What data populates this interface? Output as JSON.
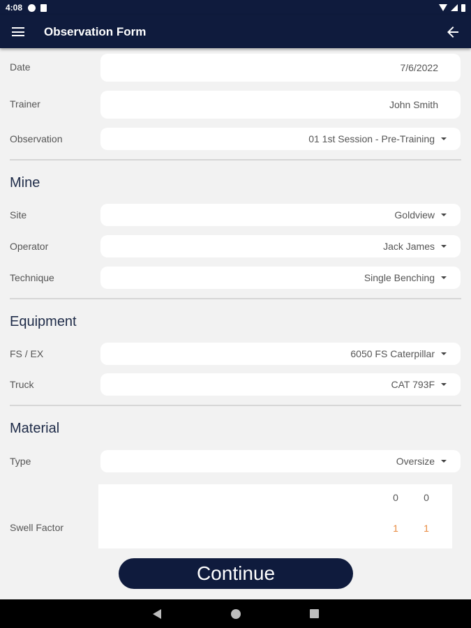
{
  "status_bar": {
    "time": "4:08"
  },
  "app_bar": {
    "title": "Observation Form",
    "menu_icon": "hamburger-menu-icon",
    "back_icon": "arrow-back-icon"
  },
  "form": {
    "date": {
      "label": "Date",
      "value": "7/6/2022"
    },
    "trainer": {
      "label": "Trainer",
      "value": "John Smith"
    },
    "observation": {
      "label": "Observation",
      "value": "01 1st Session - Pre-Training"
    },
    "mine": {
      "title": "Mine",
      "site": {
        "label": "Site",
        "value": "Goldview"
      },
      "operator": {
        "label": "Operator",
        "value": "Jack James"
      },
      "technique": {
        "label": "Technique",
        "value": "Single Benching"
      }
    },
    "equipment": {
      "title": "Equipment",
      "fs_ex": {
        "label": "FS / EX",
        "value": "6050 FS Caterpillar"
      },
      "truck": {
        "label": "Truck",
        "value": "CAT 793F"
      }
    },
    "material": {
      "title": "Material",
      "type": {
        "label": "Type",
        "value": "Oversize"
      },
      "swell_factor": {
        "label": "Swell Factor",
        "top_values": [
          "0",
          "0"
        ],
        "bottom_values": [
          "1",
          "1"
        ]
      }
    }
  },
  "continue_label": "Continue",
  "colors": {
    "primary": "#0f1b3d",
    "background": "#f2f2f2",
    "accent": "#e8893e"
  }
}
